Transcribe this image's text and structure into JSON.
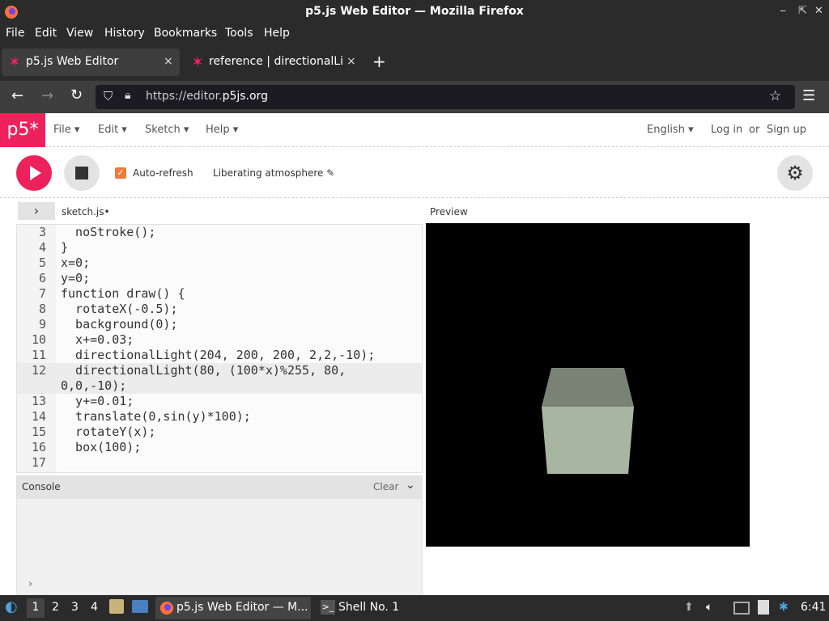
{
  "window": {
    "title": "p5.js Web Editor — Mozilla Firefox"
  },
  "menubar": {
    "items": [
      "File",
      "Edit",
      "View",
      "History",
      "Bookmarks",
      "Tools",
      "Help"
    ]
  },
  "tabs": [
    {
      "label": "p5.js Web Editor",
      "close": "×"
    },
    {
      "label": "reference | directionalLig",
      "close": "×"
    }
  ],
  "newtab": "+",
  "nav": {
    "url_prefix": "https://editor.",
    "url_domain": "p5js.org"
  },
  "p5": {
    "logo": "p5*",
    "menu": {
      "file": "File ▾",
      "edit": "Edit ▾",
      "sketch": "Sketch ▾",
      "help": "Help ▾"
    },
    "lang": "English ▾",
    "login": "Log in",
    "or": "or",
    "signup": "Sign up",
    "auto_refresh": "Auto-refresh",
    "auto_refresh_checked": true,
    "sketch_name": "Liberating atmosphere ✎",
    "file_tab": "sketch.js•",
    "preview_label": "Preview",
    "console_label": "Console",
    "clear_label": "Clear",
    "prompt": "›"
  },
  "code_lines": [
    {
      "n": "3",
      "text": "  noStroke();"
    },
    {
      "n": "4",
      "text": "}"
    },
    {
      "n": "5",
      "text": "x=0;"
    },
    {
      "n": "6",
      "text": "y=0;"
    },
    {
      "n": "7",
      "text": "function draw() {"
    },
    {
      "n": "8",
      "text": "  rotateX(-0.5);"
    },
    {
      "n": "9",
      "text": "  background(0);"
    },
    {
      "n": "10",
      "text": "  x+=0.03;"
    },
    {
      "n": "11",
      "text": "  directionalLight(204, 200, 200, 2,2,-10);"
    },
    {
      "n": "12",
      "text": "  directionalLight(80, (100*x)%255, 80,"
    },
    {
      "n": "",
      "text": "0,0,-10);"
    },
    {
      "n": "13",
      "text": "  y+=0.01;"
    },
    {
      "n": "14",
      "text": "  translate(0,sin(y)*100);"
    },
    {
      "n": "15",
      "text": "  rotateY(x);"
    },
    {
      "n": "16",
      "text": "  box(100);"
    },
    {
      "n": "17",
      "text": ""
    }
  ],
  "taskbar": {
    "workspaces": [
      "1",
      "2",
      "3",
      "4"
    ],
    "tasks": [
      "p5.js Web Editor — M...",
      "Shell No. 1"
    ],
    "time": "6:41"
  },
  "colors": {
    "accent": "#ed225d",
    "checkbox": "#ed7c3d",
    "cube_top": "#7a8275",
    "cube_front": "#a7b5a2"
  }
}
